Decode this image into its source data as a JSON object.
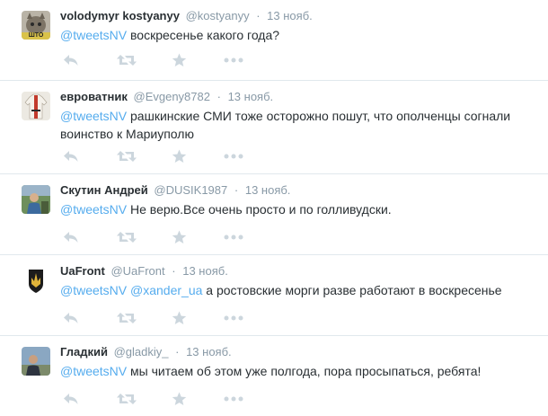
{
  "tweets": [
    {
      "fullname": "volodymyr kostyanyy",
      "handle": "@kostyanyy",
      "separator": "·",
      "time": "13 нояб.",
      "mentions": [
        "@tweetsNV"
      ],
      "text": " воскресенье какого года?",
      "avatar_label": "ШТО"
    },
    {
      "fullname": "евроватник",
      "handle": "@Evgeny8782",
      "separator": "·",
      "time": "13 нояб.",
      "mentions": [
        "@tweetsNV"
      ],
      "text": " рашкинские СМИ тоже осторожно пошут, что ополченцы согнали воинство к Мариуполю"
    },
    {
      "fullname": "Скутин Андрей",
      "handle": "@DUSIK1987",
      "separator": "·",
      "time": "13 нояб.",
      "mentions": [
        "@tweetsNV"
      ],
      "text": " Не верю.Все очень просто и по голливудски."
    },
    {
      "fullname": "UaFront",
      "handle": "@UaFront",
      "separator": "·",
      "time": "13 нояб.",
      "mentions": [
        "@tweetsNV",
        "@xander_ua"
      ],
      "text": " а ростовские морги разве работают в воскресенье"
    },
    {
      "fullname": "Гладкий",
      "handle": "@gladkiy_",
      "separator": "·",
      "time": "13 нояб.",
      "mentions": [
        "@tweetsNV"
      ],
      "text": " мы читаем об этом уже полгода, пора просыпаться, ребята!"
    }
  ],
  "icons": [
    "reply-icon",
    "retweet-icon",
    "favorite-icon",
    "more-icon"
  ],
  "colors": {
    "link": "#55acee",
    "meta": "#8899a6",
    "icon": "#ccd6dd",
    "divider": "#e1e8ed"
  }
}
